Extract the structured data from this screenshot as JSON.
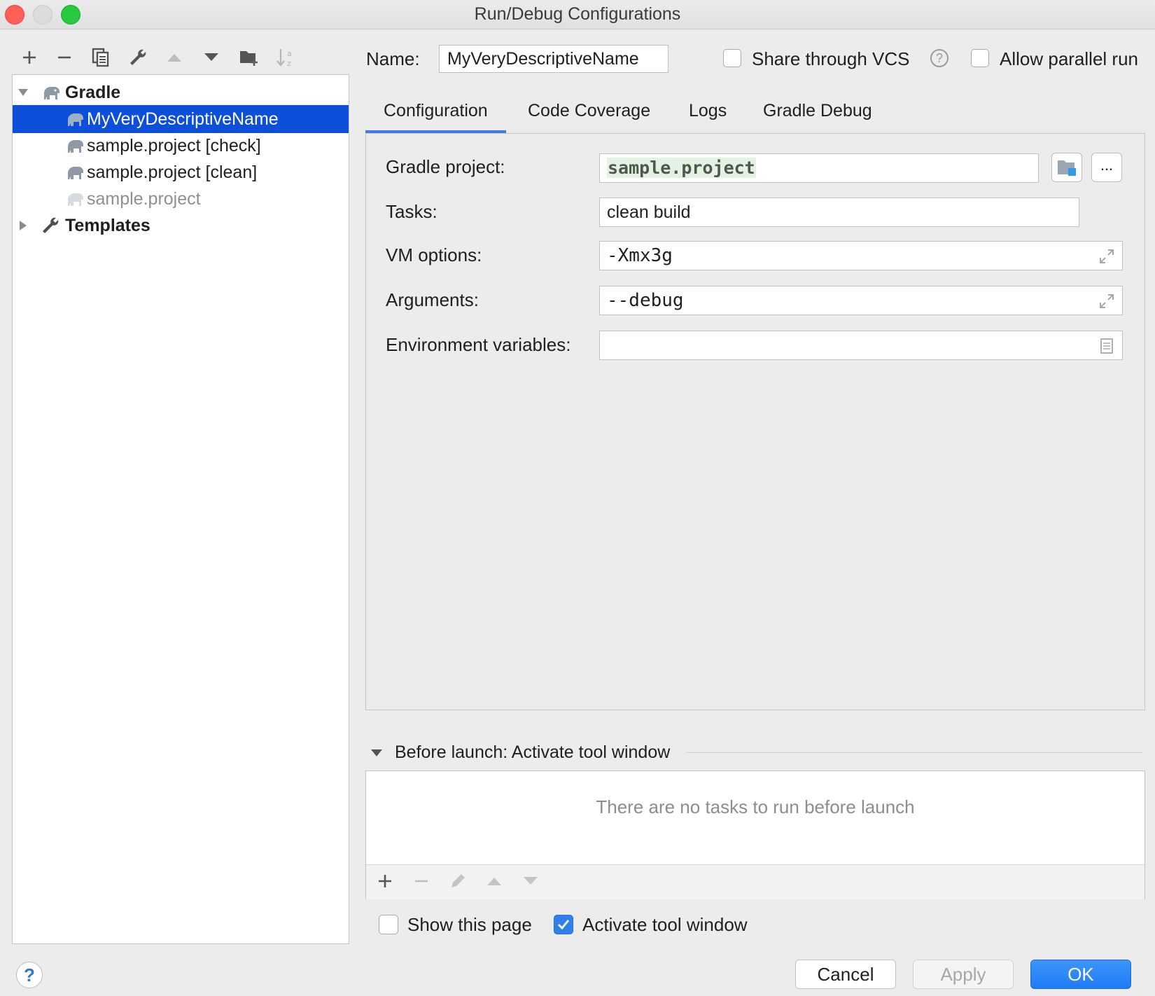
{
  "window": {
    "title": "Run/Debug Configurations"
  },
  "toolbar": {
    "icons": [
      "plus-icon",
      "minus-icon",
      "copy-icon",
      "wrench-icon",
      "move-up-icon",
      "move-down-icon",
      "new-folder-icon",
      "sort-alpha-icon"
    ]
  },
  "tree": {
    "groups": [
      {
        "label": "Gradle",
        "expanded": true,
        "icon": "gradle-elephant-icon",
        "items": [
          {
            "label": "MyVeryDescriptiveName",
            "selected": true
          },
          {
            "label": "sample.project [check]",
            "selected": false
          },
          {
            "label": "sample.project [clean]",
            "selected": false
          },
          {
            "label": "sample.project",
            "selected": false,
            "dimmed": true
          }
        ]
      },
      {
        "label": "Templates",
        "expanded": false,
        "icon": "wrench-icon"
      }
    ]
  },
  "header": {
    "name_label": "Name:",
    "name_value": "MyVeryDescriptiveName",
    "share_vcs_label": "Share through VCS",
    "share_vcs_checked": false,
    "help_glyph": "?",
    "parallel_label": "Allow parallel run",
    "parallel_checked": false
  },
  "tabs": [
    {
      "label": "Configuration",
      "active": true
    },
    {
      "label": "Code Coverage",
      "active": false
    },
    {
      "label": "Logs",
      "active": false
    },
    {
      "label": "Gradle Debug",
      "active": false
    }
  ],
  "form": {
    "gradle_project_label": "Gradle project:",
    "gradle_project_value": "sample.project",
    "browse_glyph": "...",
    "tasks_label": "Tasks:",
    "tasks_value": "clean build",
    "vm_options_label": "VM options:",
    "vm_options_value": "-Xmx3g",
    "arguments_label": "Arguments:",
    "arguments_value": "--debug",
    "env_label": "Environment variables:",
    "env_value": ""
  },
  "before_launch": {
    "title": "Before launch: Activate tool window",
    "empty_text": "There are no tasks to run before launch"
  },
  "footer": {
    "show_page_label": "Show this page",
    "show_page_checked": false,
    "activate_label": "Activate tool window",
    "activate_checked": true,
    "help_glyph": "?",
    "cancel_label": "Cancel",
    "apply_label": "Apply",
    "ok_label": "OK"
  },
  "colors": {
    "selection": "#0e4fd9",
    "primary_button": "#1f7bf4",
    "tab_underline": "#3d7ddc"
  }
}
